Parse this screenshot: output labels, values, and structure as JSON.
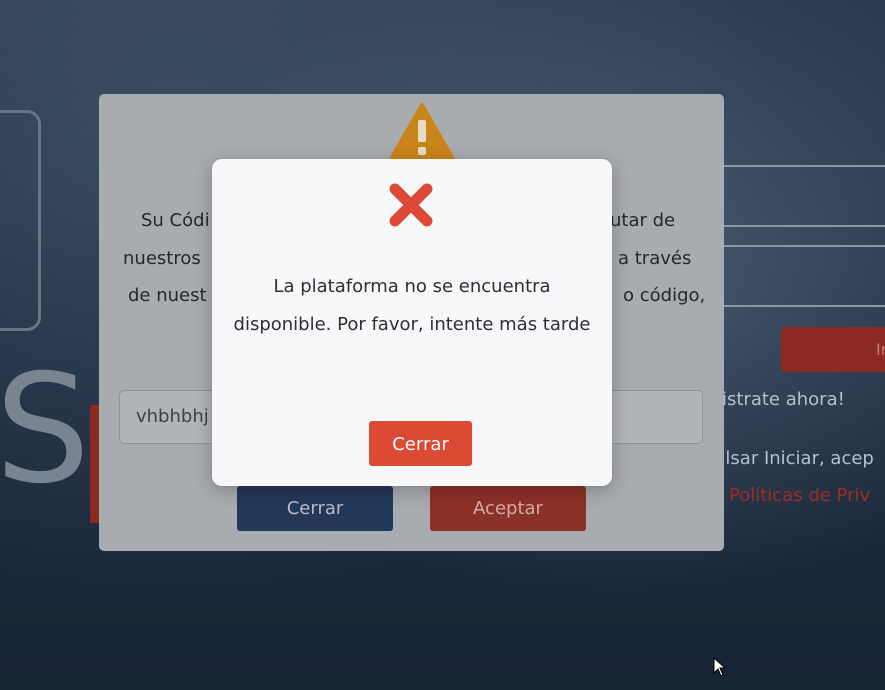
{
  "background": {
    "logo_text": "SÉ",
    "login_button_label": "In",
    "register_text": "istrate ahora!",
    "terms_text": "ulsar Iniciar, acep",
    "privacy_link": "Políticas de Priv"
  },
  "code_dialog": {
    "icon": "warning-icon",
    "message_lines": [
      "Su Códi",
      "utar de",
      "nuestros",
      "a través",
      "de nuest",
      "o código,"
    ],
    "code_input_value": "vhbhbhj",
    "close_label": "Cerrar",
    "accept_label": "Aceptar"
  },
  "error_modal": {
    "icon": "error-x-icon",
    "message": "La plataforma no se encuentra disponible. Por favor, intente más tarde",
    "close_label": "Cerrar",
    "icon_color": "#dc4935",
    "button_color": "#dc4935"
  }
}
